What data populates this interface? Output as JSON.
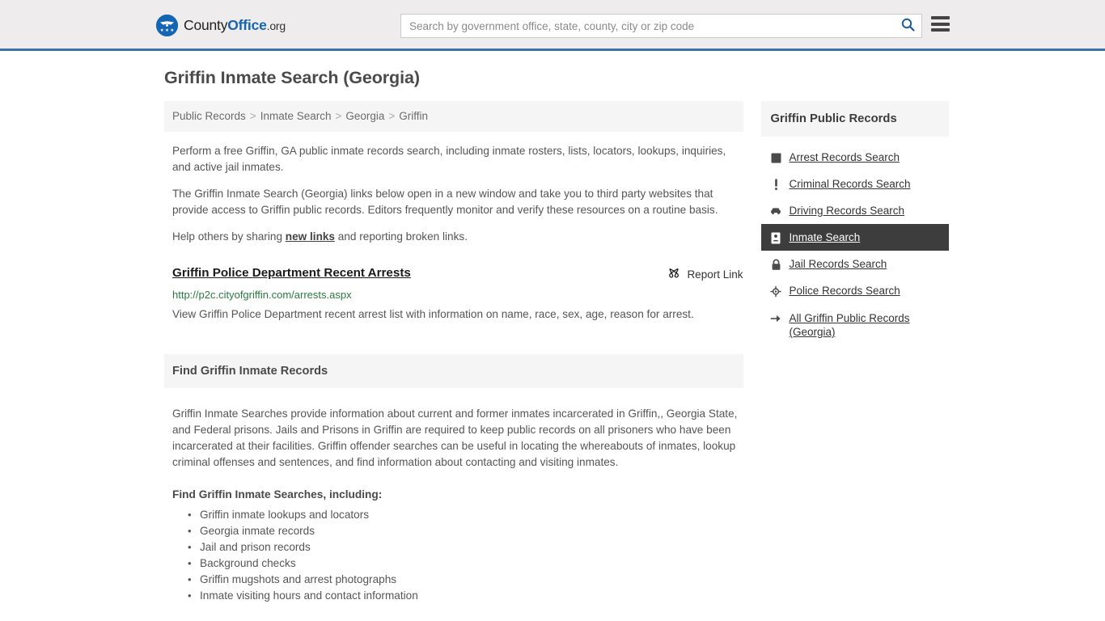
{
  "header": {
    "logo": {
      "icon": "eagle-shield-icon",
      "text_part1": "County",
      "text_part2": "Office",
      "text_tld": ".org"
    },
    "search": {
      "placeholder": "Search by government office, state, county, city or zip code",
      "value": "",
      "button_icon": "search-icon"
    },
    "menu_icon": "hamburger-menu-icon",
    "accent_color": "#3b73a8",
    "background_color": "#eeecec"
  },
  "page": {
    "title": "Griffin Inmate Search (Georgia)"
  },
  "breadcrumb": {
    "items": [
      {
        "label": "Public Records"
      },
      {
        "label": "Inmate Search"
      },
      {
        "label": "Georgia"
      },
      {
        "label": "Griffin"
      }
    ],
    "separator": ">"
  },
  "intro": {
    "paragraph1": "Perform a free Griffin, GA public inmate records search, including inmate rosters, lists, locators, lookups, inquiries, and active jail inmates.",
    "paragraph2": "The Griffin Inmate Search (Georgia) links below open in a new window and take you to third party websites that provide access to Griffin public records. Editors frequently monitor and verify these resources on a routine basis.",
    "paragraph3_before": "Help others by sharing ",
    "paragraph3_link": "new links",
    "paragraph3_after": " and reporting broken links."
  },
  "result": {
    "title": "Griffin Police Department Recent Arrests",
    "url": "http://p2c.cityofgriffin.com/arrests.aspx",
    "description": "View Griffin Police Department recent arrest list with information on name, race, sex, age, reason for arrest.",
    "report": {
      "label": "Report Link",
      "icon": "broken-link-icon"
    },
    "url_color": "#2a7a3f"
  },
  "section": {
    "heading": "Find Griffin Inmate Records",
    "lead": "Griffin Inmate Searches provide information about current and former inmates incarcerated in Griffin,, Georgia State, and Federal prisons. Jails and Prisons in Griffin are required to keep public records on all prisoners who have been incarcerated at their facilities. Griffin offender searches can be useful in locating the whereabouts of inmates, lookup criminal offenses and sentences, and find information about contacting and visiting inmates.",
    "subheading": "Find Griffin Inmate Searches, including:",
    "list": [
      "Griffin inmate lookups and locators",
      "Georgia inmate records",
      "Jail and prison records",
      "Background checks",
      "Griffin mugshots and arrest photographs",
      "Inmate visiting hours and contact information"
    ]
  },
  "sidebar": {
    "heading": "Griffin Public Records",
    "active_background": "#3d3d3d",
    "items": [
      {
        "label": "Arrest Records Search",
        "icon": "square-badge-icon",
        "active": false
      },
      {
        "label": "Criminal Records Search",
        "icon": "exclamation-icon",
        "active": false
      },
      {
        "label": "Driving Records Search",
        "icon": "car-icon",
        "active": false
      },
      {
        "label": "Inmate Search",
        "icon": "id-card-icon",
        "active": true
      },
      {
        "label": "Jail Records Search",
        "icon": "lock-icon",
        "active": false
      },
      {
        "label": "Police Records Search",
        "icon": "police-badge-icon",
        "active": false
      },
      {
        "label": "All Griffin Public Records (Georgia)",
        "icon": "arrow-right-icon",
        "active": false
      }
    ]
  }
}
